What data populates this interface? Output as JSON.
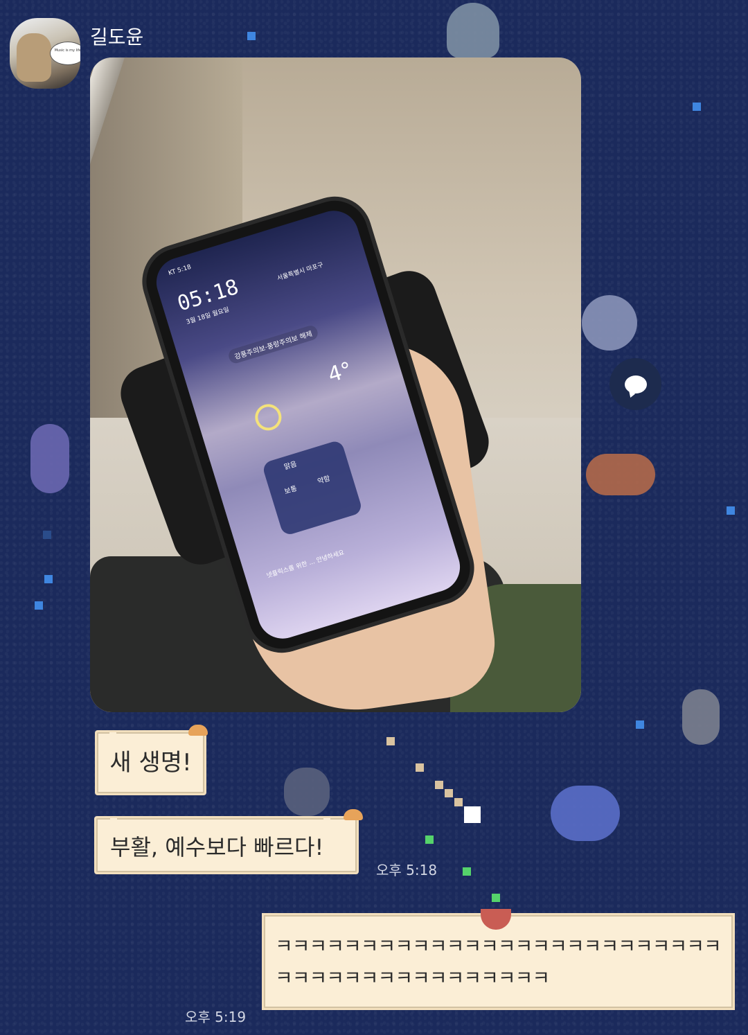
{
  "chat": {
    "sender_name": "길도윤",
    "avatar_caption": "Music is my life",
    "photo": {
      "phone_time": "05:18",
      "phone_status": "KT 5:18",
      "phone_date": "3월 18일 월요일",
      "phone_location": "서울특별시 마포구",
      "phone_alert": "강풍주의보·풍랑주의보 해제",
      "phone_temp": "4°",
      "phone_card_title": "맑음",
      "phone_card_item1": "보통",
      "phone_card_item2": "약함",
      "phone_news": "넷플릭스를 위한 ... 안녕하세요"
    },
    "messages": [
      {
        "text": "새 생명!"
      },
      {
        "text": "부활, 예수보다 빠르다!",
        "time": "오후 5:18"
      },
      {
        "text": "ㅋㅋㅋㅋㅋㅋㅋㅋㅋㅋㅋㅋㅋㅋㅋㅋㅋㅋㅋㅋㅋㅋㅋㅋㅋㅋㅋㅋㅋㅋㅋㅋㅋㅋㅋㅋㅋㅋㅋㅋㅋㅋ",
        "time": "오후 5:19"
      }
    ]
  },
  "icons": {
    "reply": "speech-bubble-icon"
  },
  "colors": {
    "background": "#1b2a5c",
    "bubble": "#fbeed6",
    "accent_blue": "#3f86e0"
  }
}
